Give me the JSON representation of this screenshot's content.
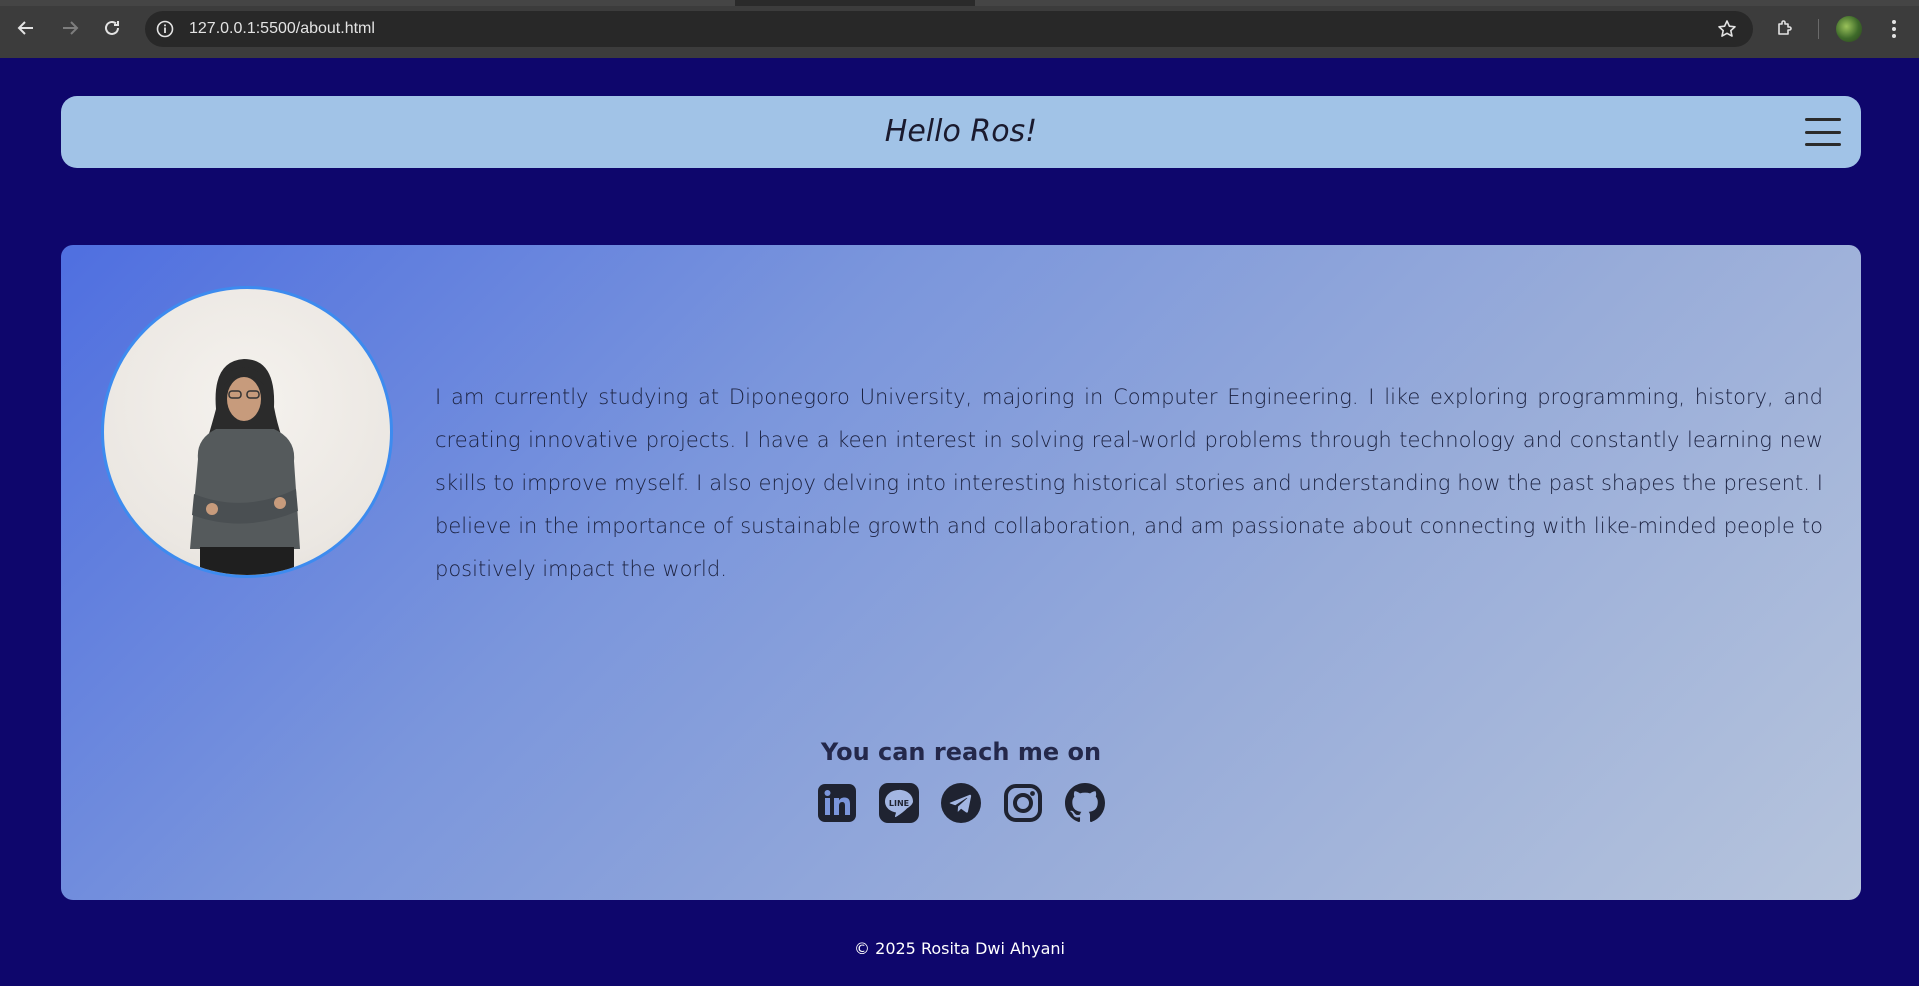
{
  "browser": {
    "url": "127.0.0.1:5500/about.html"
  },
  "header": {
    "title": "Hello Ros!"
  },
  "about": {
    "bio": "I am currently studying at Diponegoro University, majoring in Computer Engineering. I like exploring programming, history, and creating innovative projects. I have a keen interest in solving real-world problems through technology and constantly learning new skills to improve myself. I also enjoy delving into interesting historical stories and understanding how the past shapes the present. I believe in the importance of sustainable growth and collaboration, and am passionate about connecting with like-minded people to positively impact the world."
  },
  "contact": {
    "heading": "You can reach me on",
    "icons": [
      "linkedin-icon",
      "line-icon",
      "telegram-icon",
      "instagram-icon",
      "github-icon"
    ]
  },
  "footer": {
    "text": "© 2025 Rosita Dwi Ahyani"
  },
  "colors": {
    "page_background": "#0e066c",
    "header_background": "#a1c3e7",
    "avatar_border": "#3d8bef"
  }
}
